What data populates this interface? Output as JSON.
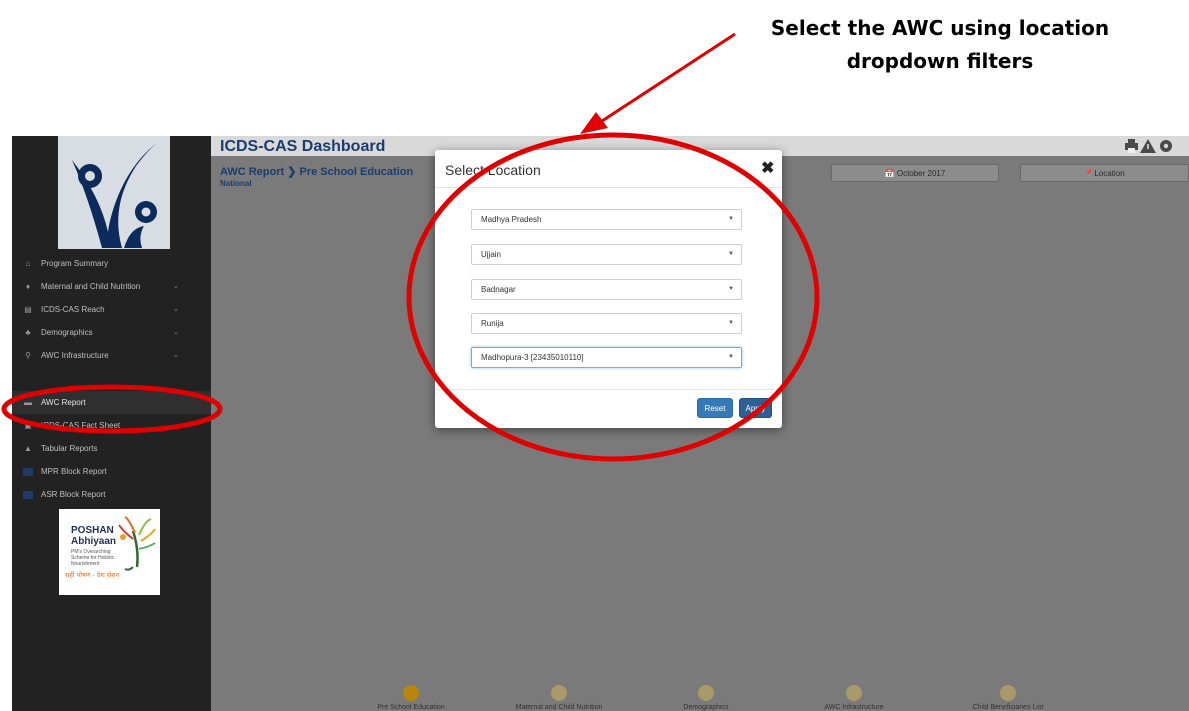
{
  "annotation": {
    "line1": "Select the AWC using location",
    "line2": "dropdown filters"
  },
  "header": {
    "title": "ICDS-CAS Dashboard",
    "breadcrumb": "AWC Report ❯ Pre School Education",
    "level": "National",
    "date_filter": "📅 October 2017",
    "location_filter": "📍Location",
    "tool_icons": [
      "print-icon",
      "warning-icon",
      "gear-icon"
    ]
  },
  "sidebar": {
    "items": [
      {
        "label": "Program Summary",
        "icon": "home-icon",
        "glyph": "⌂"
      },
      {
        "label": "Maternal and Child Nutrition",
        "icon": "person-icon",
        "glyph": "♦",
        "chevron": "⌄"
      },
      {
        "label": "ICDS-CAS Reach",
        "icon": "bar-chart-icon",
        "glyph": "▤",
        "chevron": "⌄"
      },
      {
        "label": "Demographics",
        "icon": "users-icon",
        "glyph": "♣",
        "chevron": "⌄"
      },
      {
        "label": "AWC Infrastructure",
        "icon": "map-marker-icon",
        "glyph": "⚲",
        "chevron": "⌄"
      },
      {
        "label": "AWC Report",
        "icon": "report-icon",
        "glyph": "▬"
      },
      {
        "label": "ICDS-CAS Fact Sheet",
        "icon": "fact-sheet-icon",
        "glyph": "▣"
      },
      {
        "label": "Tabular Reports",
        "icon": "table-icon",
        "glyph": "▲"
      },
      {
        "label": "MPR Block Report",
        "icon": "mpr-icon",
        "glyph": ""
      },
      {
        "label": "ASR Block Report",
        "icon": "asr-icon",
        "glyph": ""
      }
    ],
    "poshan": {
      "title1": "POSHAN",
      "title2": "Abhiyaan",
      "tagline1": "PM's Overarching",
      "tagline2": "Scheme for Holistic",
      "tagline3": "Nourishment",
      "hindi": "सही पोषण - देश रोशन"
    }
  },
  "modal": {
    "title": "Select Location",
    "close": "✖",
    "selects": [
      "Madhya Pradesh",
      "Ujjain",
      "Badnagar",
      "Runija",
      "Madhopura-3 [23435010110]"
    ],
    "reset_label": "Reset",
    "apply_label": "Apply"
  },
  "bottom_nav": [
    {
      "label": "Pre School Education",
      "color": "#b8860b"
    },
    {
      "label": "Maternal and Child Nutrition",
      "color": "#a89a6a"
    },
    {
      "label": "Demographics",
      "color": "#a89a6a"
    },
    {
      "label": "AWC Infrastructure",
      "color": "#a89a6a"
    },
    {
      "label": "Child Beneficiaries List",
      "color": "#a89a6a"
    }
  ],
  "colors": {
    "sidebar_bg": "#222222",
    "content_bg": "#7a7a7a",
    "annotation_red": "#e00000",
    "brand_blue": "#1a3d6e"
  }
}
